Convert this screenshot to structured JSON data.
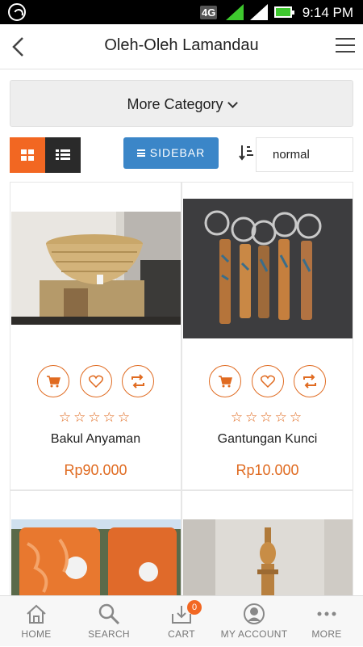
{
  "status_bar": {
    "network": "4G",
    "time": "9:14 PM"
  },
  "header": {
    "title": "Oleh-Oleh Lamandau"
  },
  "category_dropdown": {
    "label": "More Category"
  },
  "toolbar": {
    "sidebar_label": "SIDEBAR",
    "sort_value": "normal"
  },
  "products": [
    {
      "name": "Bakul Anyaman",
      "price": "Rp90.000",
      "rating": 0,
      "stars": "☆☆☆☆☆"
    },
    {
      "name": "Gantungan Kunci",
      "price": "Rp10.000",
      "rating": 0,
      "stars": "☆☆☆☆☆"
    }
  ],
  "bottom_nav": {
    "home": "HOME",
    "search": "SEARCH",
    "cart": "CART",
    "cart_count": "0",
    "account": "MY ACCOUNT",
    "more": "MORE"
  },
  "colors": {
    "accent": "#f26722",
    "sidebar_button": "#3b86c8",
    "price": "#e06b21"
  }
}
